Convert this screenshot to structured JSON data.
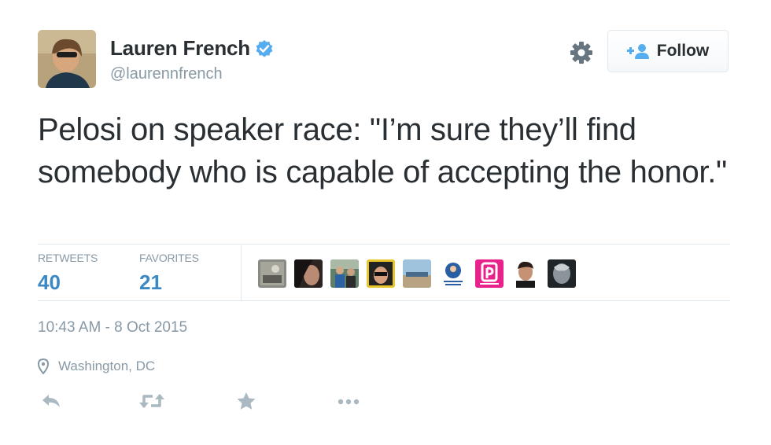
{
  "author": {
    "name": "Lauren French",
    "handle": "@laurennfrench",
    "verified": true,
    "verified_color": "#55acee"
  },
  "header": {
    "settings_icon": "gear-icon",
    "follow_label": "Follow",
    "follow_icon": "add-user-icon",
    "follow_icon_color": "#55acee"
  },
  "tweet": {
    "text": "Pelosi on speaker race: \"I’m sure they’ll find somebody who is capable of accepting the honor.\""
  },
  "stats": {
    "retweets_label": "RETWEETS",
    "retweets_count": "40",
    "favorites_label": "FAVORITES",
    "favorites_count": "21",
    "accent_color": "#3b88c3"
  },
  "favoriters": [
    {
      "name": "favoriter-avatar-1"
    },
    {
      "name": "favoriter-avatar-2"
    },
    {
      "name": "favoriter-avatar-3"
    },
    {
      "name": "favoriter-avatar-4"
    },
    {
      "name": "favoriter-avatar-5"
    },
    {
      "name": "favoriter-avatar-6"
    },
    {
      "name": "favoriter-avatar-7"
    },
    {
      "name": "favoriter-avatar-8"
    },
    {
      "name": "favoriter-avatar-9"
    }
  ],
  "meta": {
    "timestamp": "10:43 AM - 8 Oct 2015",
    "location": "Washington, DC"
  },
  "actions": [
    {
      "name": "reply-icon"
    },
    {
      "name": "retweet-icon"
    },
    {
      "name": "favorite-icon"
    },
    {
      "name": "more-icon"
    }
  ]
}
